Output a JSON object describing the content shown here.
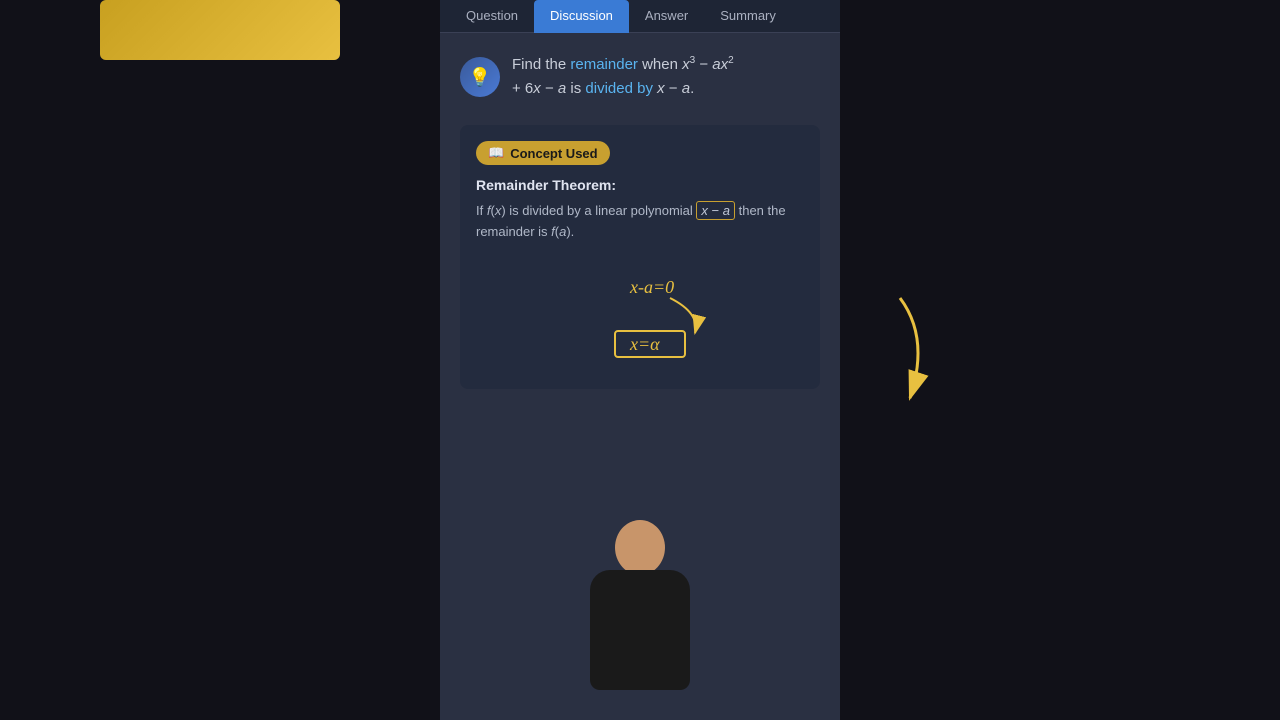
{
  "tabs": [
    {
      "label": "Question",
      "active": false
    },
    {
      "label": "Discussion",
      "active": true
    },
    {
      "label": "Answer",
      "active": false
    },
    {
      "label": "Summary",
      "active": false
    }
  ],
  "question": {
    "icon": "💡",
    "text_prefix": "Find the ",
    "highlight1": "remainder",
    "text_mid": " when ",
    "expression": "x³ − ax²",
    "text_suffix": "+ 6x − a is ",
    "highlight2": "divided by",
    "divisor": " x − a."
  },
  "concept": {
    "badge_label": "Concept Used",
    "badge_icon": "📖",
    "theorem_title": "Remainder Theorem:",
    "theorem_text_pre": "If f(x) is divided by a linear polynomial ",
    "theorem_boxed": "x − a",
    "theorem_text_post": " then the remainder is f(a).",
    "diagram_line1": "x-a=0",
    "diagram_line2": "x=a"
  },
  "colors": {
    "accent_blue": "#5ab4f0",
    "accent_orange": "#c8a030",
    "bg_center": "#2a3042",
    "tab_active": "#3a7bd5"
  }
}
